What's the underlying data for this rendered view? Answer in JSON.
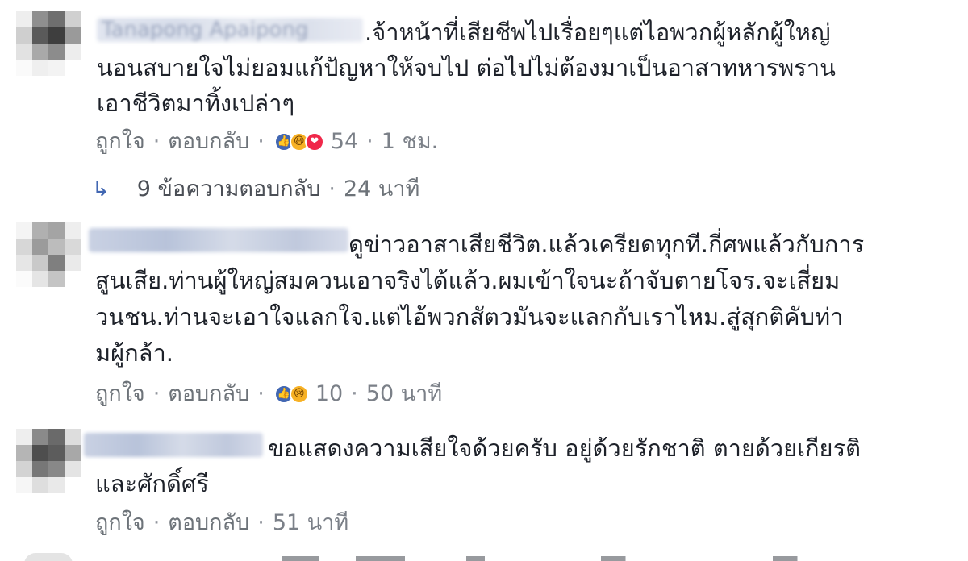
{
  "comments": [
    {
      "name": "Tanapong Apaipong",
      "lines": [
        ".จ้าหน้าที่เสียชีพไปเรื่อยๆแต่ไอพวกผู้หลักผู้ใหญ่",
        "นอนสบายใจไม่ยอมแก้ปัญหาให้จบไป ต่อไปไม่ต้องมาเป็นอาสาทหารพราน",
        "เอาชีวิตมาทิ้งเปล่าๆ"
      ],
      "like_label": "ถูกใจ",
      "reply_label": "ตอบกลับ",
      "reaction_icons": [
        "like-icon",
        "haha-icon",
        "love-icon"
      ],
      "reaction_count": "54",
      "time": "1 ชม.",
      "replies_label": "9 ข้อความตอบกลับ",
      "replies_time": "24 นาที"
    },
    {
      "name": "",
      "lines": [
        "ดูข่าวอาสาเสียชีวิต.แล้วเครียดทุกที.กี่ศพแล้วกับการ",
        "สูนเสีย.ท่านผู้ใหญ่สมควนเอาจริงได้แล้ว.ผมเข้าใจนะถ้าจับตายโจร.จะเสี่ยม",
        "วนชน.ท่านจะเอาใจแลกใจ.แต่ไอ้พวกสัตวมันจะแลกกับเราไหม.สู่สุกติคับท่า",
        "มผู้กล้า."
      ],
      "like_label": "ถูกใจ",
      "reply_label": "ตอบกลับ",
      "reaction_icons": [
        "like-icon",
        "sad-icon"
      ],
      "reaction_count": "10",
      "time": "50 นาที"
    },
    {
      "name": "",
      "lines": [
        "ขอแสดงความเสียใจด้วยครับ อยู่ด้วยรักชาติ ตายด้วยเกียรติ",
        "และศักดิ์ศรี"
      ],
      "like_label": "ถูกใจ",
      "reply_label": "ตอบกลับ",
      "time": "51 นาที"
    }
  ],
  "colors": {
    "text": "#1d2129",
    "meta": "#7b8088",
    "like_blue": "#4267b2",
    "love_red": "#f0284a",
    "haha_yellow": "#f7b125"
  }
}
